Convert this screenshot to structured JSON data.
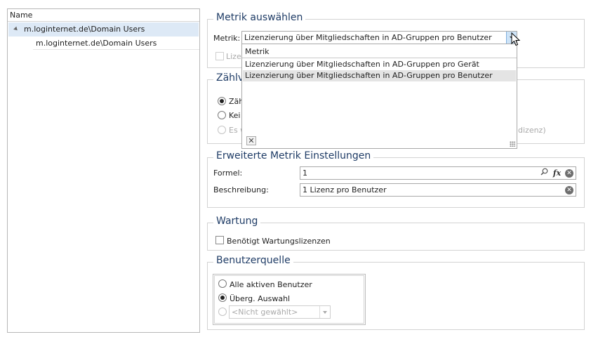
{
  "tree": {
    "header": "Name",
    "items": [
      {
        "label": "m.loginternet.de\\Domain Users"
      },
      {
        "label": "m.loginternet.de\\Domain Users"
      }
    ]
  },
  "metric_section": {
    "title": "Metrik auswählen",
    "metric_label": "Metrik:",
    "metric_value": "Lizenzierung über Mitgliedschaften in AD-Gruppen pro Benutzer",
    "hidden_checkbox_label_fragment": "Lizen"
  },
  "dropdown": {
    "search_text": "Metrik",
    "options": [
      "Lizenzierung über Mitgliedschaften in AD-Gruppen pro Gerät",
      "Lizenzierung über Mitgliedschaften in AD-Gruppen pro Benutzer"
    ],
    "selected_index": 1,
    "close_glyph": "✕"
  },
  "counter_section": {
    "title_fragment": "Zählve",
    "option_1_fragment": "Zäh",
    "option_2_fragment": "Kei",
    "option_3_fragment": "Es w",
    "option_3_tail_fragment": "dizenz)"
  },
  "advanced_section": {
    "title": "Erweiterte Metrik Einstellungen",
    "formula_label": "Formel:",
    "formula_value": "1",
    "description_label": "Beschreibung:",
    "description_value": "1 Lizenz pro Benutzer",
    "fx_glyph": "fx",
    "clear_glyph": "✕"
  },
  "maintenance_section": {
    "title": "Wartung",
    "checkbox_label": "Benötigt Wartungslizenzen"
  },
  "user_source_section": {
    "title": "Benutzerquelle",
    "options": [
      "Alle aktiven Benutzer",
      "Überg. Auswahl"
    ],
    "select_placeholder": "<Nicht gewählt>",
    "selected_index": 1
  },
  "colors": {
    "accent_title": "#1f3c66",
    "selection": "#dde9f6",
    "dropdown_button": "#cde3f7"
  }
}
